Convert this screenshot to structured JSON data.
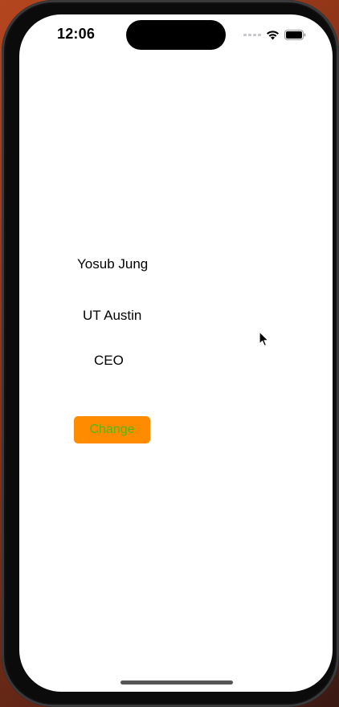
{
  "status_bar": {
    "time": "12:06"
  },
  "profile": {
    "name": "Yosub Jung",
    "school": "UT Austin",
    "role": "CEO"
  },
  "actions": {
    "change_label": "Change"
  },
  "colors": {
    "button_background": "#ff8c00",
    "button_text": "#4cbb17"
  },
  "icons": {
    "signal": "cellular-signal-icon",
    "wifi": "wifi-icon",
    "battery": "battery-icon",
    "cursor": "mouse-pointer-icon"
  }
}
